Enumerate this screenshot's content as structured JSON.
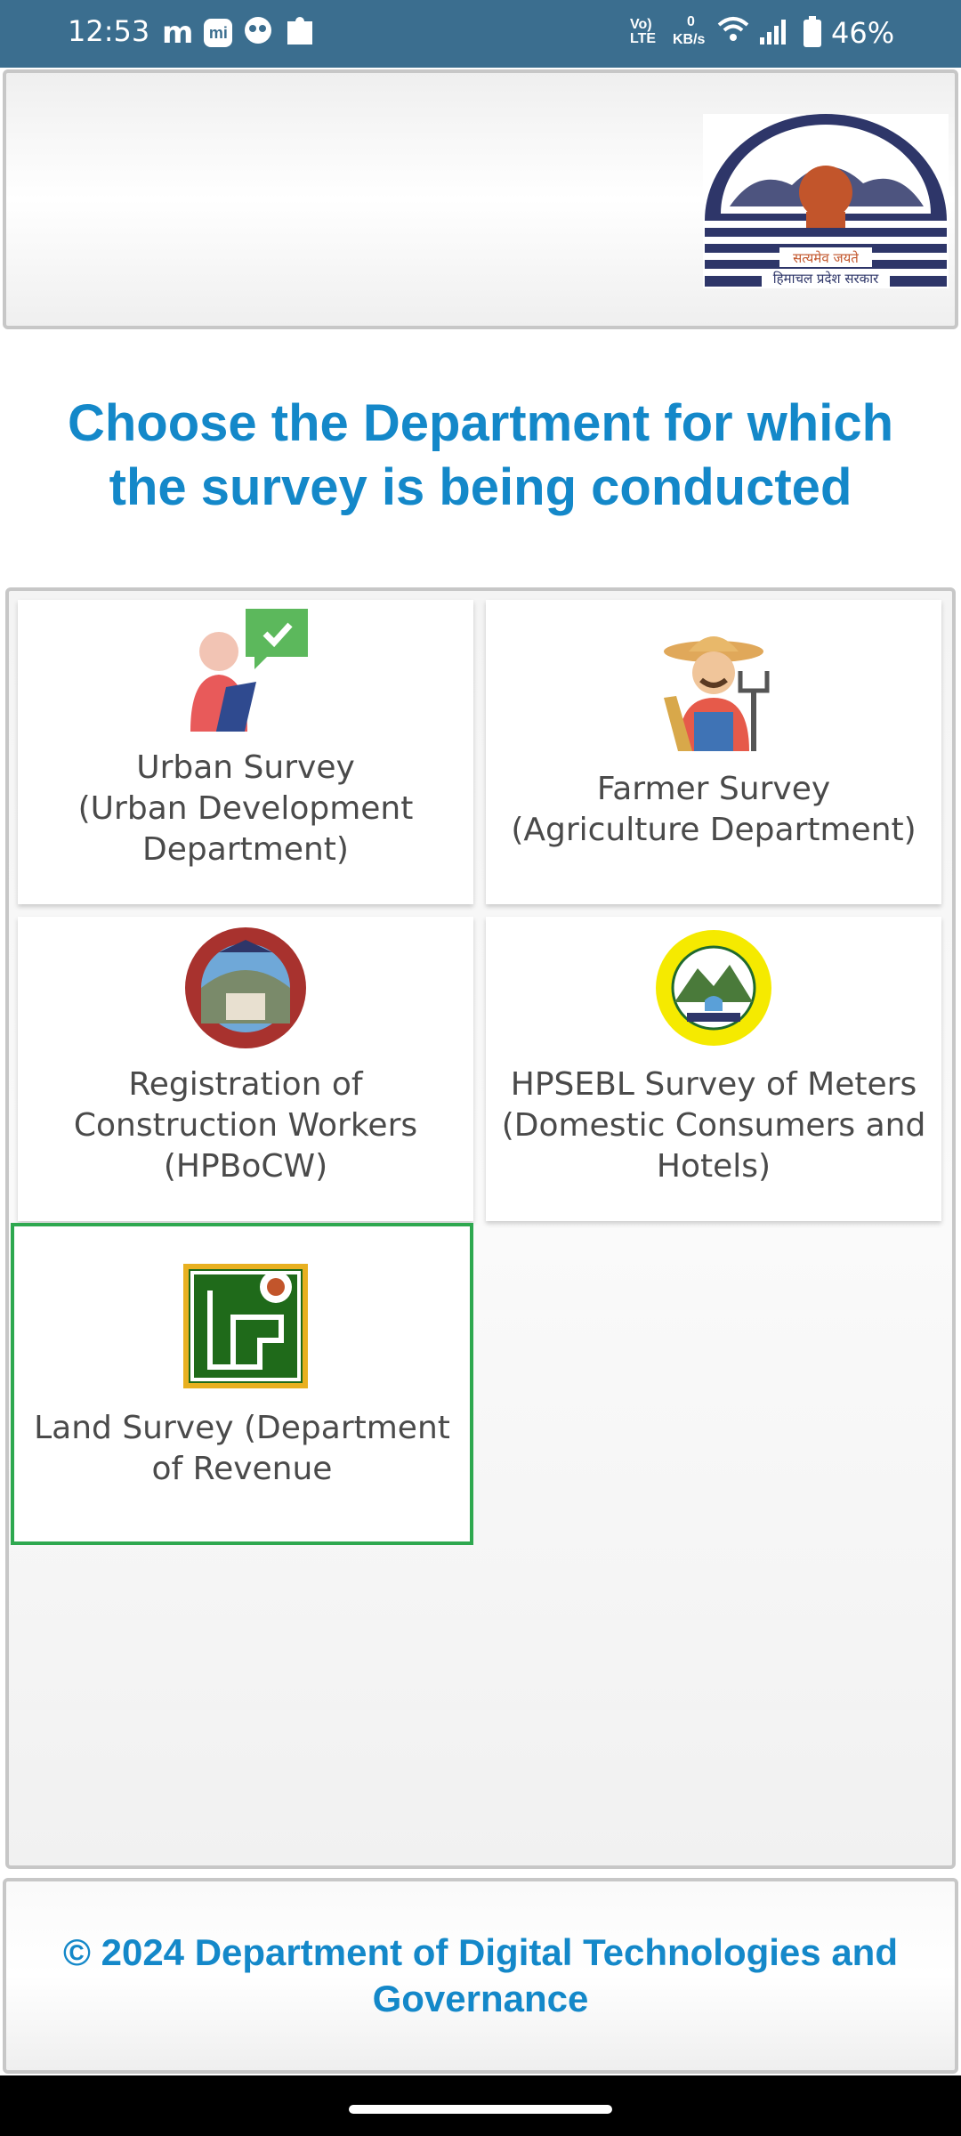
{
  "status_bar": {
    "time": "12:53",
    "network_type": "Vo) LTE",
    "speed_value": "0",
    "speed_unit": "KB/s",
    "battery_percent": "46%",
    "notification_icons": [
      "m-app-icon",
      "mi-icon",
      "chat-icon",
      "puzzle-icon"
    ]
  },
  "header": {
    "emblem_text_line1": "सत्यमेव जयते",
    "emblem_text_line2": "हिमाचल प्रदेश सरकार"
  },
  "page_title": "Choose the Department for which the survey is being conducted",
  "tiles": [
    {
      "label": "Urban Survey\n(Urban Development\nDepartment)",
      "icon": "urban-survey-icon"
    },
    {
      "label": "Farmer Survey\n(Agriculture Department)",
      "icon": "farmer-icon"
    },
    {
      "label": "Registration of\nConstruction Workers\n(HPBoCW)",
      "icon": "hpbocw-logo-icon"
    },
    {
      "label": "HPSEBL Survey of Meters\n(Domestic Consumers and\nHotels)",
      "icon": "hpsebl-logo-icon"
    },
    {
      "label": "Land Survey (Department\nof Revenue",
      "icon": "land-survey-icon",
      "selected": true
    }
  ],
  "footer": "© 2024 Department of Digital Technologies and Governance",
  "colors": {
    "accent": "#1488c9",
    "status_bar": "#3b6e8f",
    "selected_border": "#2ea84f"
  }
}
